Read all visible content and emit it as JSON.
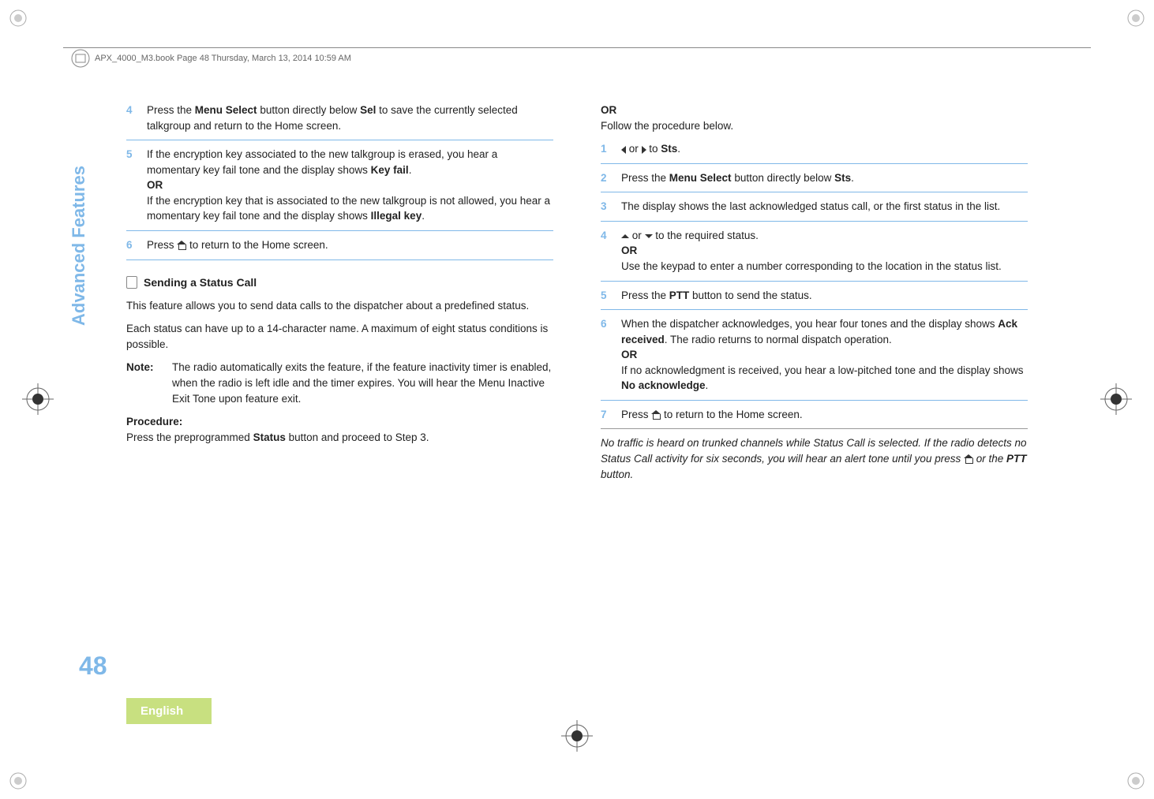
{
  "header": {
    "text": "APX_4000_M3.book  Page 48  Thursday, March 13, 2014  10:59 AM"
  },
  "sidebar": {
    "label": "Advanced Features"
  },
  "page_number": "48",
  "language": "English",
  "left_col": {
    "step4": {
      "num": "4",
      "text_a": "Press the ",
      "bold_a": "Menu Select",
      "text_b": " button directly below ",
      "ui_a": "Sel",
      "text_c": " to save the currently selected talkgroup and return to the Home screen."
    },
    "step5": {
      "num": "5",
      "text_a": "If the encryption key associated to the new talkgroup is erased, you hear a momentary key fail tone and the display shows ",
      "ui_a": "Key fail",
      "text_b": ".",
      "or": "OR",
      "text_c": "If the encryption key that is associated to the new talkgroup is not allowed, you hear a momentary key fail tone and the display shows ",
      "ui_b": "Illegal key",
      "text_d": "."
    },
    "step6": {
      "num": "6",
      "text_a": "Press ",
      "text_b": " to return to the Home screen."
    },
    "section_title": "Sending a Status Call",
    "para1": "This feature allows you to send data calls to the dispatcher about a predefined status.",
    "para2": "Each status can have up to a 14-character name. A maximum of eight status conditions is possible.",
    "note": {
      "label": "Note:",
      "text": "The radio automatically exits the feature, if the feature inactivity timer is enabled, when the radio is left idle and the timer expires. You will hear the Menu Inactive Exit Tone upon feature exit."
    },
    "procedure_label": "Procedure:",
    "procedure_text_a": "Press the preprogrammed ",
    "procedure_bold": "Status",
    "procedure_text_b": " button and proceed to Step 3."
  },
  "right_col": {
    "or_top": "OR",
    "follow": "Follow the procedure below.",
    "step1": {
      "num": "1",
      "text_a": " or ",
      "text_b": " to ",
      "ui_a": "Sts",
      "text_c": "."
    },
    "step2": {
      "num": "2",
      "text_a": "Press the ",
      "bold_a": "Menu Select",
      "text_b": " button directly below ",
      "ui_a": "Sts",
      "text_c": "."
    },
    "step3": {
      "num": "3",
      "text": "The display shows the last acknowledged status call, or the first status in the list."
    },
    "step4": {
      "num": "4",
      "text_a": " or ",
      "text_b": " to the required status.",
      "or": "OR",
      "text_c": "Use the keypad to enter a number corresponding to the location in the status list."
    },
    "step5": {
      "num": "5",
      "text_a": "Press the ",
      "bold_a": "PTT",
      "text_b": " button to send the status."
    },
    "step6": {
      "num": "6",
      "text_a": "When the dispatcher acknowledges, you hear four tones and the display shows ",
      "ui_a": "Ack received",
      "text_b": ". The radio returns to normal dispatch operation.",
      "or": "OR",
      "text_c": "If no acknowledgment is received, you hear a low-pitched tone and the display shows ",
      "ui_b": "No acknowledge",
      "text_d": "."
    },
    "step7": {
      "num": "7",
      "text_a": "Press ",
      "text_b": " to return to the Home screen."
    },
    "footer_a": "No traffic is heard on trunked channels while Status Call is selected. If the radio detects no Status Call activity for six seconds, you will hear an alert tone until you press ",
    "footer_b": " or the ",
    "footer_ptt": "PTT",
    "footer_c": " button."
  }
}
